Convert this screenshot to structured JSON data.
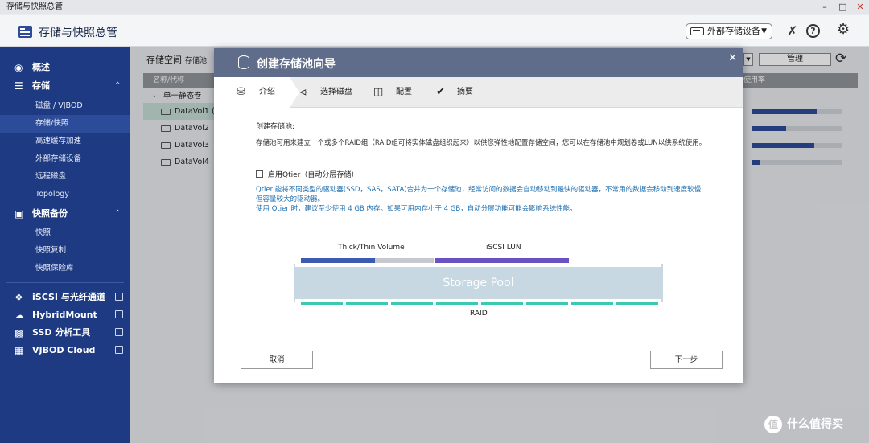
{
  "window": {
    "title": "存储与快照总管"
  },
  "header": {
    "app_title": "存储与快照总管",
    "external_device_label": "外部存储设备"
  },
  "sidebar": {
    "overview": "概述",
    "storage": {
      "label": "存储",
      "items": [
        "磁盘 / VJBOD",
        "存储/快照",
        "高速缓存加速",
        "外部存储设备",
        "远程磁盘",
        "Topology"
      ]
    },
    "snapshot_backup": {
      "label": "快照备份",
      "items": [
        "快照",
        "快照复制",
        "快照保险库"
      ]
    },
    "links": [
      "iSCSI 与光纤通道",
      "HybridMount",
      "SSD 分析工具",
      "VJBOD Cloud"
    ]
  },
  "background": {
    "section_title": "存储空间",
    "section_subtitle": "存储池:",
    "table_headers": [
      "名称/代称",
      "使用率"
    ],
    "group_label": "单一静态卷",
    "rows": [
      "DataVol1 (",
      "DataVol2",
      "DataVol3",
      "DataVol4"
    ],
    "usage": [
      0.72,
      0.38,
      0.7,
      0.1
    ],
    "manage_button": "管理"
  },
  "dialog": {
    "title": "创建存储池向导",
    "steps": [
      "介绍",
      "选择磁盘",
      "配置",
      "摘要"
    ],
    "section_title": "创建存储池:",
    "description": "存储池可用来建立一个或多个RAID组（RAID组可将实体磁盘组织起来）以供您弹性地配置存储空间，您可以在存储池中规划卷或LUN以供系统使用。",
    "qtier_checkbox": "启用Qtier（自动分层存储）",
    "qtier_info_1": "Qtier 能将不同类型的驱动器(SSD，SAS，SATA)合并为一个存储池，经常访问的数据会自动移动到最快的驱动器，不常用的数据会移动到速度较慢但容量较大的驱动器。",
    "qtier_info_2": "使用 Qtier 时，建议至少使用 4 GB 内存。如果可用内存小于 4 GB，自动分层功能可能会影响系统性能。",
    "diagram": {
      "label_volume": "Thick/Thin Volume",
      "label_lun": "iSCSI LUN",
      "pool_label": "Storage Pool",
      "raid_label": "RAID"
    },
    "cancel_button": "取消",
    "next_button": "下一步"
  },
  "watermark": {
    "text": "什么值得买",
    "logo_char": "值"
  }
}
